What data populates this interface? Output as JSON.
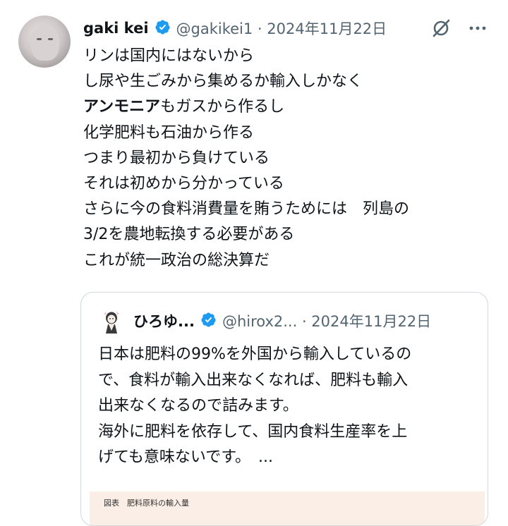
{
  "tweet": {
    "author_name": "gaki kei",
    "handle_date": "@gakikei1 · 2024年11月22日",
    "lines": [
      {
        "plain": "リンは国内にはないから",
        "bold": ""
      },
      {
        "plain": "し尿や生ごみから集めるか輸入しかなく",
        "bold": ""
      },
      {
        "bold": "アンモニア",
        "plain": "もガスから作るし"
      },
      {
        "plain": "化学肥料も石油から作る",
        "bold": ""
      },
      {
        "plain": "つまり最初から負けている",
        "bold": ""
      },
      {
        "plain": "それは初めから分かっている",
        "bold": ""
      },
      {
        "plain": "さらに今の食料消費量を賄うためには　列島の",
        "bold": ""
      },
      {
        "plain": "3/2を農地転換する必要がある",
        "bold": ""
      },
      {
        "plain": "これが統一政治の総決算だ",
        "bold": ""
      }
    ]
  },
  "quote": {
    "author_name": "ひろゆ...",
    "handle_date": "@hirox2... · 2024年11月22日",
    "lines": [
      "日本は肥料の99%を外国から輸入しているの",
      "で、食料が輸入出来なくなれば、肥料も輸入",
      "出来なくなるので詰みます。",
      "海外に肥料を依存して、国内食料生産率を上",
      "げても意味ないです。　..."
    ],
    "image_caption": "図表　肥料原料の輸入量"
  },
  "icons": {
    "verified": "verified-badge-icon",
    "grok": "grok-icon",
    "more": "more-icon"
  },
  "colors": {
    "verified_blue": "#1d9bf0",
    "secondary_text": "#536471",
    "border": "#cfd9de"
  }
}
